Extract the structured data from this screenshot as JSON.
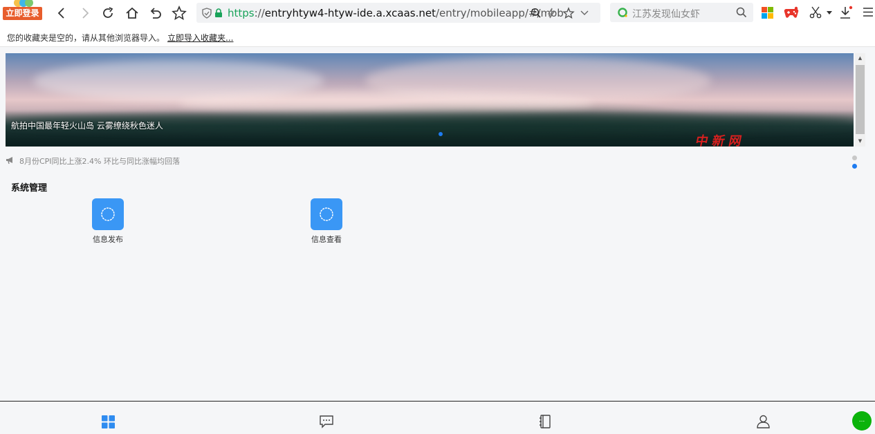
{
  "browser": {
    "login_badge": "立即登录",
    "url_scheme": "https",
    "url_sep": "://",
    "url_host": "entryhtyw4-htyw-ide.a.xcaas.net",
    "url_path": "/entry/mobileapp/#/mob",
    "search_placeholder": "江苏发现仙女虾"
  },
  "bookmarks": {
    "empty_notice": "您的收藏夹是空的，请从其他浏览器导入。",
    "import_link": "立即导入收藏夹..."
  },
  "banner": {
    "caption": "航拍中国最年轻火山岛 云雾缭绕秋色迷人",
    "stamp": "中新网"
  },
  "news": {
    "headline": "8月份CPI同比上涨2.4% 环比与同比涨幅均回落"
  },
  "section": {
    "title": "系统管理",
    "apps": [
      {
        "label": "信息发布"
      },
      {
        "label": "信息查看"
      }
    ]
  },
  "fab": {
    "label": "..."
  },
  "colors": {
    "accent": "#3a97f5",
    "active_dot": "#1e7bf0",
    "login_orange": "#e85d2c",
    "fab_green": "#0bb30b"
  }
}
